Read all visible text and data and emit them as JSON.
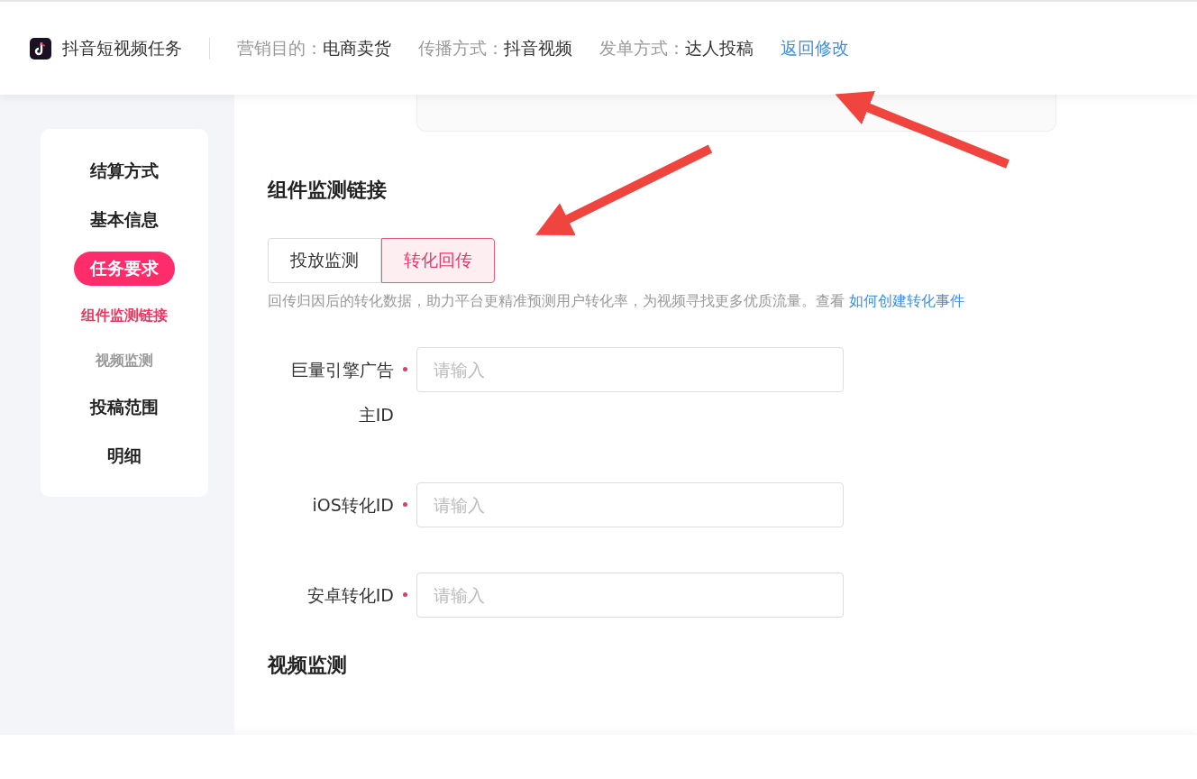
{
  "header": {
    "title": "抖音短视频任务",
    "meta": [
      {
        "label": "营销目的：",
        "value": "电商卖货"
      },
      {
        "label": "传播方式：",
        "value": "抖音视频"
      },
      {
        "label": "发单方式：",
        "value": "达人投稿"
      }
    ],
    "link": "返回修改"
  },
  "sidebar": {
    "items": [
      {
        "label": "结算方式",
        "kind": "section",
        "selected": false
      },
      {
        "label": "基本信息",
        "kind": "section",
        "selected": false
      },
      {
        "label": "任务要求",
        "kind": "section",
        "selected": true
      },
      {
        "label": "组件监测链接",
        "kind": "sub",
        "selected": true
      },
      {
        "label": "视频监测",
        "kind": "sub",
        "selected": false
      },
      {
        "label": "投稿范围",
        "kind": "section",
        "selected": false
      },
      {
        "label": "明细",
        "kind": "section",
        "selected": false
      }
    ]
  },
  "section": {
    "title": "组件监测链接",
    "tabs": [
      {
        "label": "投放监测",
        "selected": false
      },
      {
        "label": "转化回传",
        "selected": true
      }
    ],
    "hint": "回传归因后的转化数据，助力平台更精准预测用户转化率，为视频寻找更多优质流量。查看",
    "hint_link": "如何创建转化事件",
    "fields": [
      {
        "label": "巨量引擎广告主ID",
        "required": true,
        "placeholder": "请输入"
      },
      {
        "label": "iOS转化ID",
        "required": true,
        "placeholder": "请输入"
      },
      {
        "label": "安卓转化ID",
        "required": true,
        "placeholder": "请输入"
      }
    ]
  },
  "next_section": {
    "title": "视频监测"
  }
}
